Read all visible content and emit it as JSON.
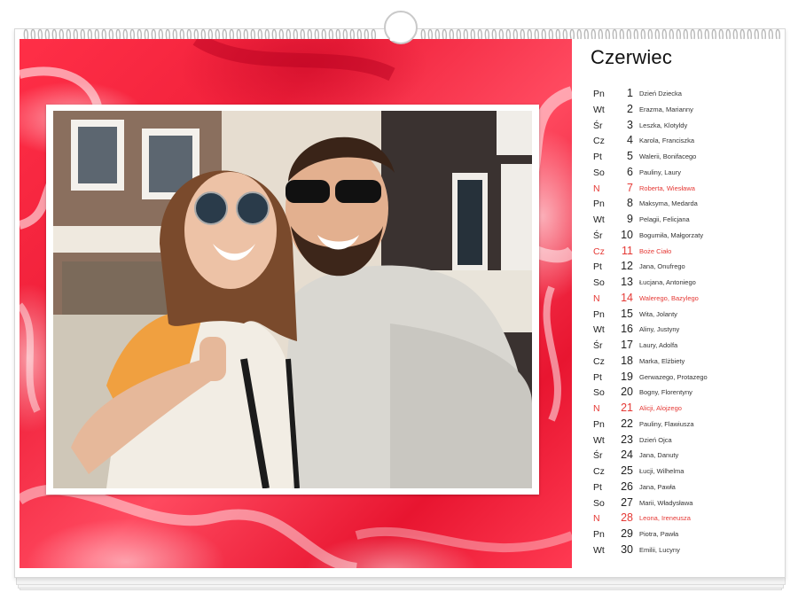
{
  "month": "Czerwiec",
  "colors": {
    "accent_red": "#e53935",
    "art_red": "#f0203a",
    "text": "#222222"
  },
  "photo": {
    "icon": "couple-selfie-photo"
  },
  "days": [
    {
      "dow": "Pn",
      "num": "1",
      "names": "Dzień Dziecka",
      "sunday": false
    },
    {
      "dow": "Wt",
      "num": "2",
      "names": "Erazma, Marianny",
      "sunday": false
    },
    {
      "dow": "Śr",
      "num": "3",
      "names": "Leszka, Klotyldy",
      "sunday": false
    },
    {
      "dow": "Cz",
      "num": "4",
      "names": "Karola, Franciszka",
      "sunday": false
    },
    {
      "dow": "Pt",
      "num": "5",
      "names": "Walerii, Bonifacego",
      "sunday": false
    },
    {
      "dow": "So",
      "num": "6",
      "names": "Pauliny, Laury",
      "sunday": false
    },
    {
      "dow": "N",
      "num": "7",
      "names": "Roberta, Wiesława",
      "sunday": true
    },
    {
      "dow": "Pn",
      "num": "8",
      "names": "Maksyma, Medarda",
      "sunday": false
    },
    {
      "dow": "Wt",
      "num": "9",
      "names": "Pelagii, Felicjana",
      "sunday": false
    },
    {
      "dow": "Śr",
      "num": "10",
      "names": "Bogumiła, Małgorzaty",
      "sunday": false
    },
    {
      "dow": "Cz",
      "num": "11",
      "names": "Boże Ciało",
      "sunday": true
    },
    {
      "dow": "Pt",
      "num": "12",
      "names": "Jana, Onufrego",
      "sunday": false
    },
    {
      "dow": "So",
      "num": "13",
      "names": "Łucjana, Antoniego",
      "sunday": false
    },
    {
      "dow": "N",
      "num": "14",
      "names": "Walerego, Bazylego",
      "sunday": true
    },
    {
      "dow": "Pn",
      "num": "15",
      "names": "Wita, Jolanty",
      "sunday": false
    },
    {
      "dow": "Wt",
      "num": "16",
      "names": "Aliny, Justyny",
      "sunday": false
    },
    {
      "dow": "Śr",
      "num": "17",
      "names": "Laury, Adolfa",
      "sunday": false
    },
    {
      "dow": "Cz",
      "num": "18",
      "names": "Marka, Elżbiety",
      "sunday": false
    },
    {
      "dow": "Pt",
      "num": "19",
      "names": "Gerwazego, Protazego",
      "sunday": false
    },
    {
      "dow": "So",
      "num": "20",
      "names": "Bogny, Florentyny",
      "sunday": false
    },
    {
      "dow": "N",
      "num": "21",
      "names": "Alicji, Alojzego",
      "sunday": true
    },
    {
      "dow": "Pn",
      "num": "22",
      "names": "Pauliny, Flawiusza",
      "sunday": false
    },
    {
      "dow": "Wt",
      "num": "23",
      "names": "Dzień Ojca",
      "sunday": false
    },
    {
      "dow": "Śr",
      "num": "24",
      "names": "Jana, Danuty",
      "sunday": false
    },
    {
      "dow": "Cz",
      "num": "25",
      "names": "Łucji, Wilhelma",
      "sunday": false
    },
    {
      "dow": "Pt",
      "num": "26",
      "names": "Jana, Pawła",
      "sunday": false
    },
    {
      "dow": "So",
      "num": "27",
      "names": "Marii, Władysława",
      "sunday": false
    },
    {
      "dow": "N",
      "num": "28",
      "names": "Leona, Ireneusza",
      "sunday": true
    },
    {
      "dow": "Pn",
      "num": "29",
      "names": "Piotra, Pawła",
      "sunday": false
    },
    {
      "dow": "Wt",
      "num": "30",
      "names": "Emilii, Lucyny",
      "sunday": false
    }
  ]
}
